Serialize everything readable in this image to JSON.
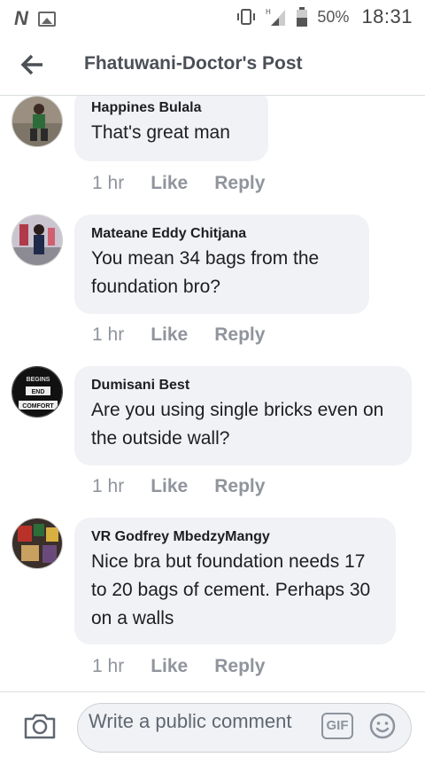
{
  "status_bar": {
    "logo": "N",
    "battery_percent": "50%",
    "time": "18:31",
    "network": "H"
  },
  "header": {
    "back_icon": "arrow-left-icon",
    "title": "Fhatuwani-Doctor's Post"
  },
  "comments": [
    {
      "author": "Happines Bulala",
      "text": "That's great man",
      "time": "1 hr",
      "like": "Like",
      "reply": "Reply"
    },
    {
      "author": "Mateane Eddy Chitjana",
      "text": "You mean 34 bags from the foundation bro?",
      "time": "1 hr",
      "like": "Like",
      "reply": "Reply"
    },
    {
      "author": "Dumisani Best",
      "text": "Are you using single bricks even on the outside wall?",
      "time": "1 hr",
      "like": "Like",
      "reply": "Reply",
      "avatar_text": [
        "BEGINS",
        "END",
        "COMFORT"
      ]
    },
    {
      "author": "VR Godfrey MbedzyMangy",
      "text": "Nice bra but foundation needs 17 to 20 bags of cement. Perhaps 30 on a walls",
      "time": "1 hr",
      "like": "Like",
      "reply": "Reply"
    }
  ],
  "composer": {
    "placeholder": "Write a public comment",
    "gif_label": "GIF",
    "camera_icon": "camera-icon",
    "emoji_icon": "smiley-icon"
  }
}
